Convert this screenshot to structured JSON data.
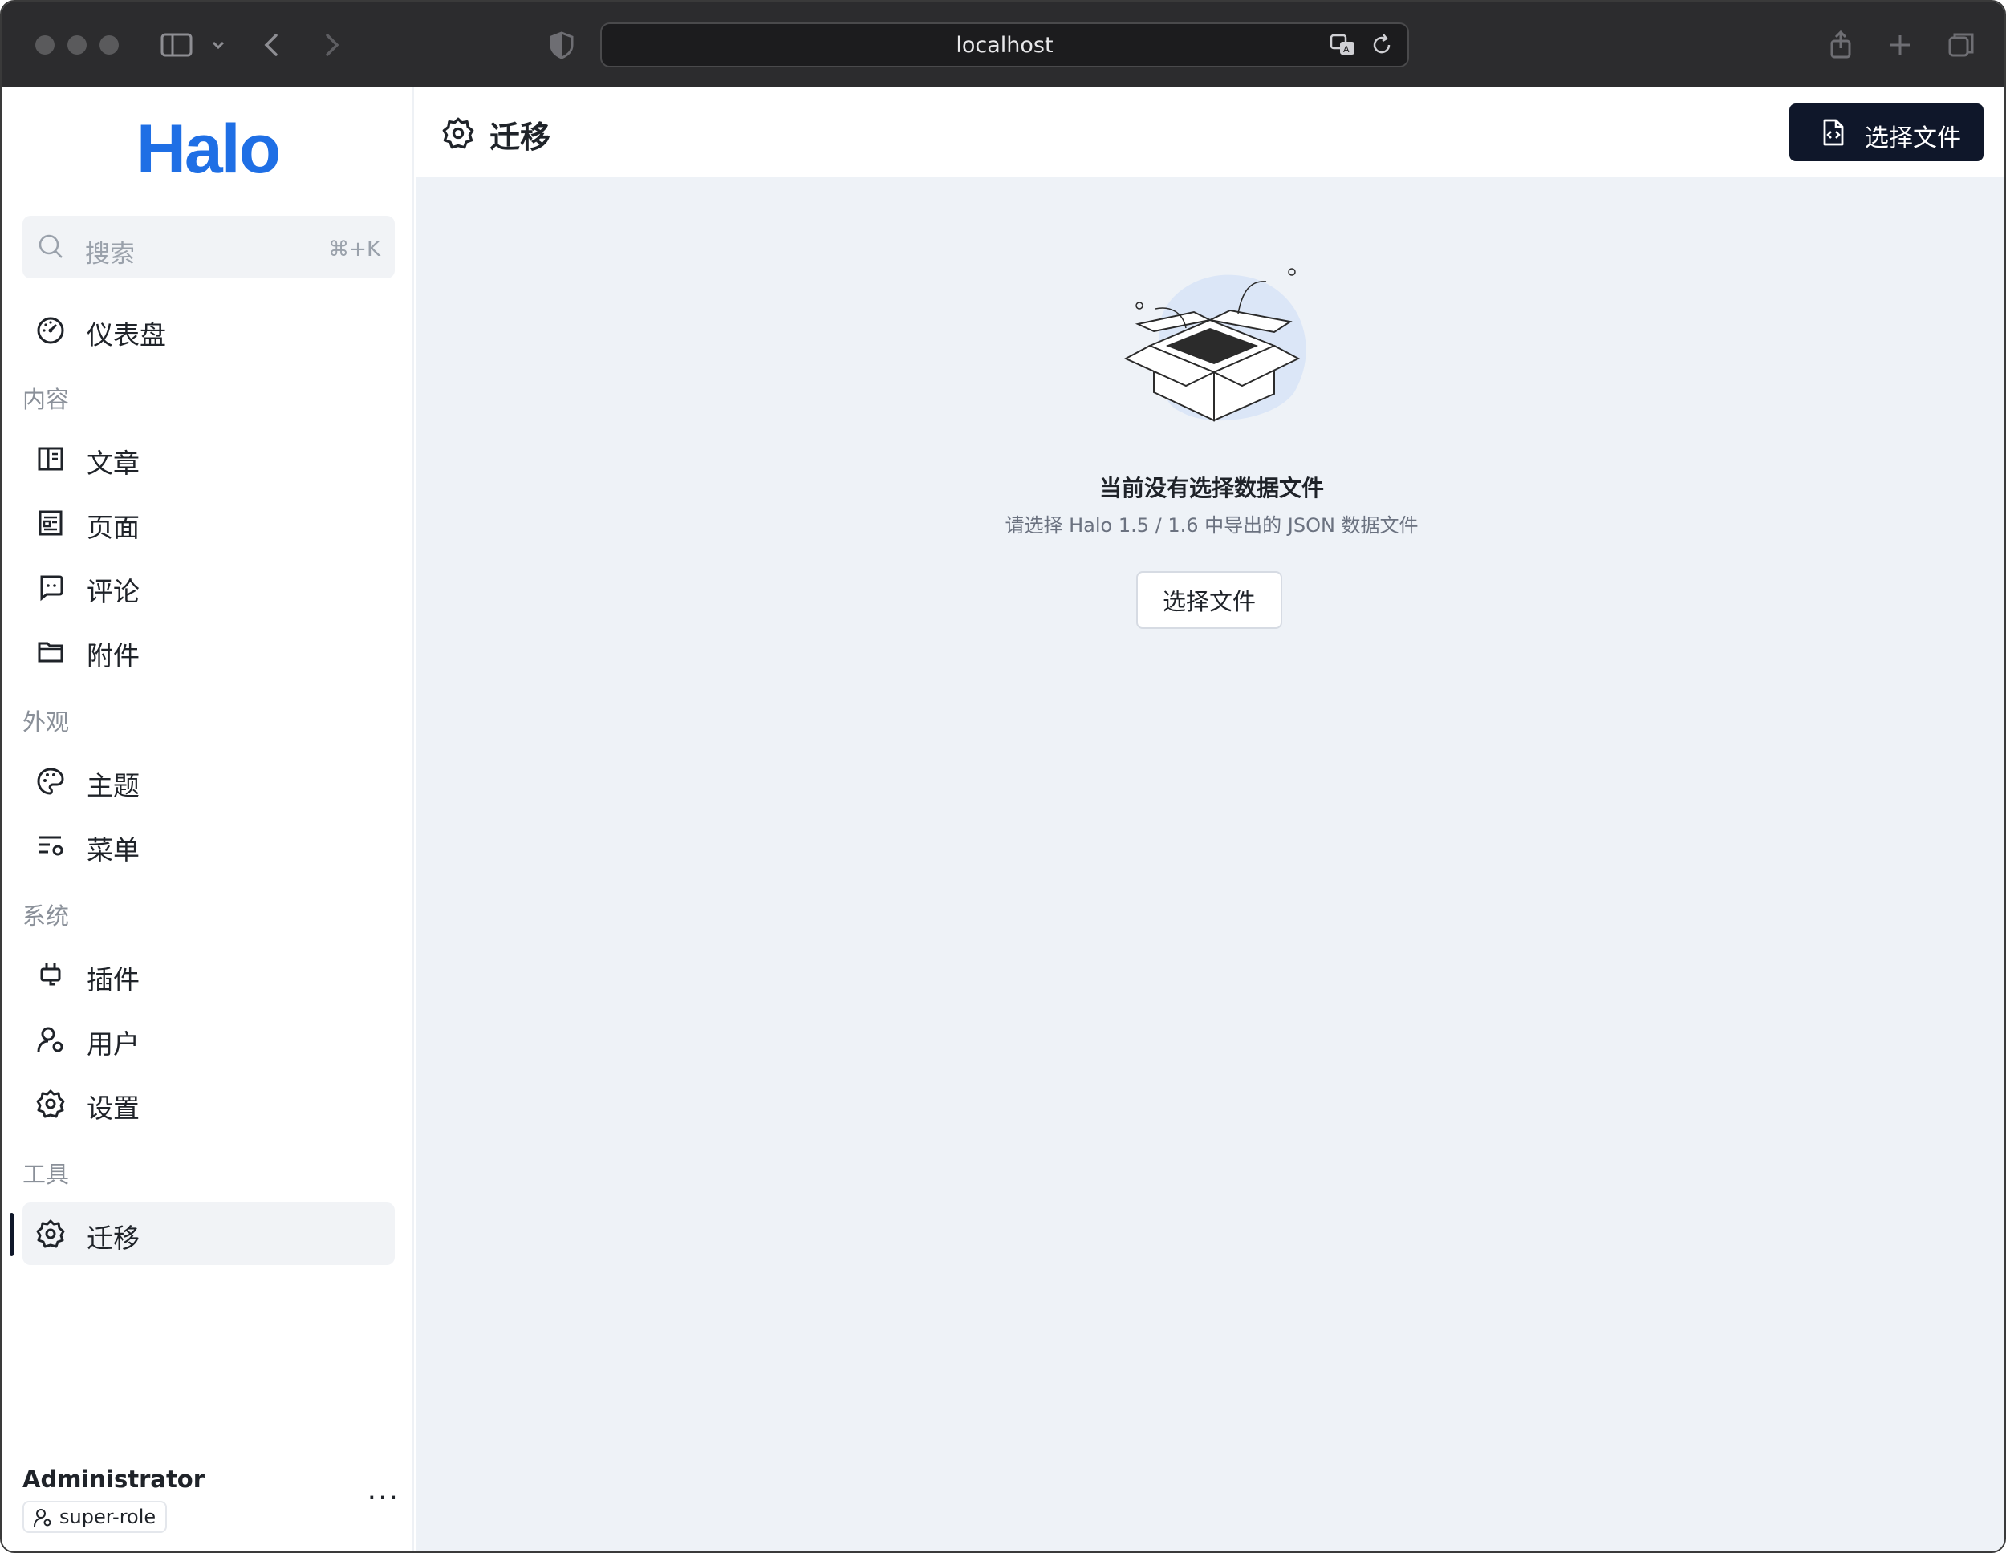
{
  "browser": {
    "url": "localhost"
  },
  "sidebar": {
    "logo": "Halo",
    "search": {
      "placeholder": "搜索",
      "shortcut": "⌘+K"
    },
    "dashboard": {
      "label": "仪表盘",
      "icon": "dashboard-icon"
    },
    "groups": [
      {
        "label": "内容",
        "items": [
          {
            "label": "文章",
            "icon": "book-icon"
          },
          {
            "label": "页面",
            "icon": "page-icon"
          },
          {
            "label": "评论",
            "icon": "comment-icon"
          },
          {
            "label": "附件",
            "icon": "folder-icon"
          }
        ]
      },
      {
        "label": "外观",
        "items": [
          {
            "label": "主题",
            "icon": "palette-icon"
          },
          {
            "label": "菜单",
            "icon": "menu-settings-icon"
          }
        ]
      },
      {
        "label": "系统",
        "items": [
          {
            "label": "插件",
            "icon": "plug-icon"
          },
          {
            "label": "用户",
            "icon": "user-settings-icon"
          },
          {
            "label": "设置",
            "icon": "gear-icon"
          }
        ]
      },
      {
        "label": "工具",
        "items": [
          {
            "label": "迁移",
            "icon": "gear-icon",
            "active": true
          }
        ]
      }
    ],
    "profile": {
      "name": "Administrator",
      "role": "super-role",
      "more": "···"
    }
  },
  "main": {
    "title": "迁移",
    "title_icon": "gear-icon",
    "primary_button": {
      "label": "选择文件",
      "icon": "file-code-icon"
    },
    "empty_state": {
      "title": "当前没有选择数据文件",
      "description": "请选择 Halo 1.5 / 1.6 中导出的 JSON 数据文件",
      "button_label": "选择文件",
      "illustration": "empty-box-illustration"
    }
  },
  "colors": {
    "brand": "#1f6fe5",
    "primary_button": "#0f172a",
    "main_background": "#eef2f7",
    "sidebar_active": "#f1f3f6"
  }
}
